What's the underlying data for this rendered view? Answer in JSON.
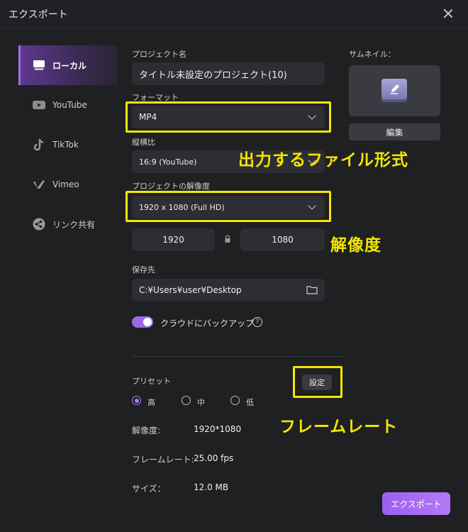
{
  "window": {
    "title": "エクスポート"
  },
  "sidebar": {
    "items": [
      {
        "label": "ローカル",
        "icon": "monitor-icon",
        "active": true
      },
      {
        "label": "YouTube",
        "icon": "youtube-icon",
        "active": false
      },
      {
        "label": "TikTok",
        "icon": "tiktok-icon",
        "active": false
      },
      {
        "label": "Vimeo",
        "icon": "vimeo-icon",
        "active": false
      },
      {
        "label": "リンク共有",
        "icon": "share-icon",
        "active": false
      }
    ]
  },
  "project": {
    "name_label": "プロジェクト名",
    "name_value": "タイトル未設定のプロジェクト(10)",
    "format_label": "フォーマット",
    "format_value": "MP4",
    "aspect_label": "縦横比",
    "aspect_value": "16:9 (YouTube)",
    "resolution_label": "プロジェクトの解像度",
    "resolution_value": "1920 x 1080 (Full HD)",
    "width_value": "1920",
    "height_value": "1080",
    "save_label": "保存先",
    "save_value": "C:¥Users¥user¥Desktop",
    "cloud_backup_label": "クラウドにバックアップ",
    "cloud_backup_on": true
  },
  "thumbnail": {
    "label": "サムネイル：",
    "edit_label": "編集"
  },
  "preset": {
    "label": "プリセット",
    "settings_label": "設定",
    "options": [
      {
        "label": "高",
        "selected": true
      },
      {
        "label": "中",
        "selected": false
      },
      {
        "label": "低",
        "selected": false
      }
    ],
    "info": [
      {
        "key": "解像度:",
        "value": "1920*1080"
      },
      {
        "key": "フレームレート:",
        "value": "25.00 fps"
      },
      {
        "key": "サイズ：",
        "value": "12.0 MB"
      }
    ]
  },
  "annotations": {
    "file_format": "出力するファイル形式",
    "resolution": "解像度",
    "frame_rate": "フレームレート"
  },
  "actions": {
    "export_label": "エクスポート"
  },
  "colors": {
    "accent": "#9d6ae6",
    "highlight": "#f5e600",
    "background": "#1f2022"
  }
}
